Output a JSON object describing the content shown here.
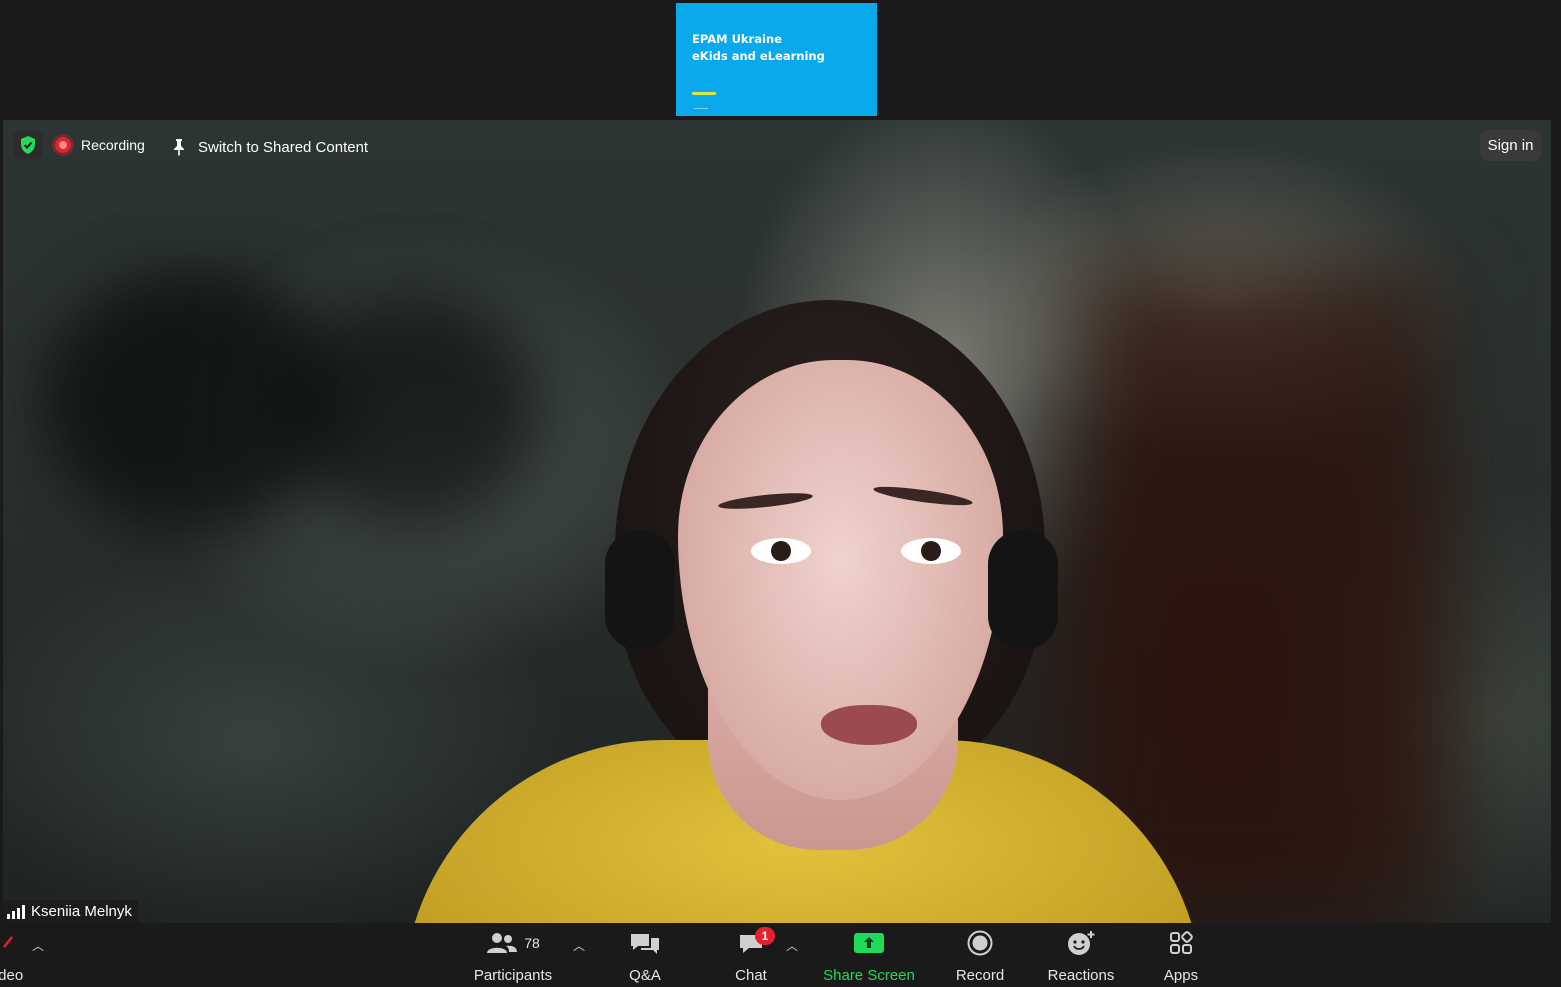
{
  "shared_content": {
    "title_line1": "EPAM Ukraine",
    "title_line2": "eKids and eLearning"
  },
  "top_bar": {
    "recording_label": "Recording",
    "switch_label": "Switch to Shared Content",
    "sign_in_label": "Sign in"
  },
  "participant": {
    "name": "Kseniia Melnyk"
  },
  "toolbar": {
    "video_label": "ideo",
    "participants_label": "Participants",
    "participants_count": "78",
    "qa_label": "Q&A",
    "chat_label": "Chat",
    "chat_badge": "1",
    "share_screen_label": "Share Screen",
    "record_label": "Record",
    "reactions_label": "Reactions",
    "apps_label": "Apps"
  },
  "colors": {
    "accent_green": "#23d959",
    "recording_red": "#e0232e",
    "slide_blue": "#0aa9ec"
  }
}
